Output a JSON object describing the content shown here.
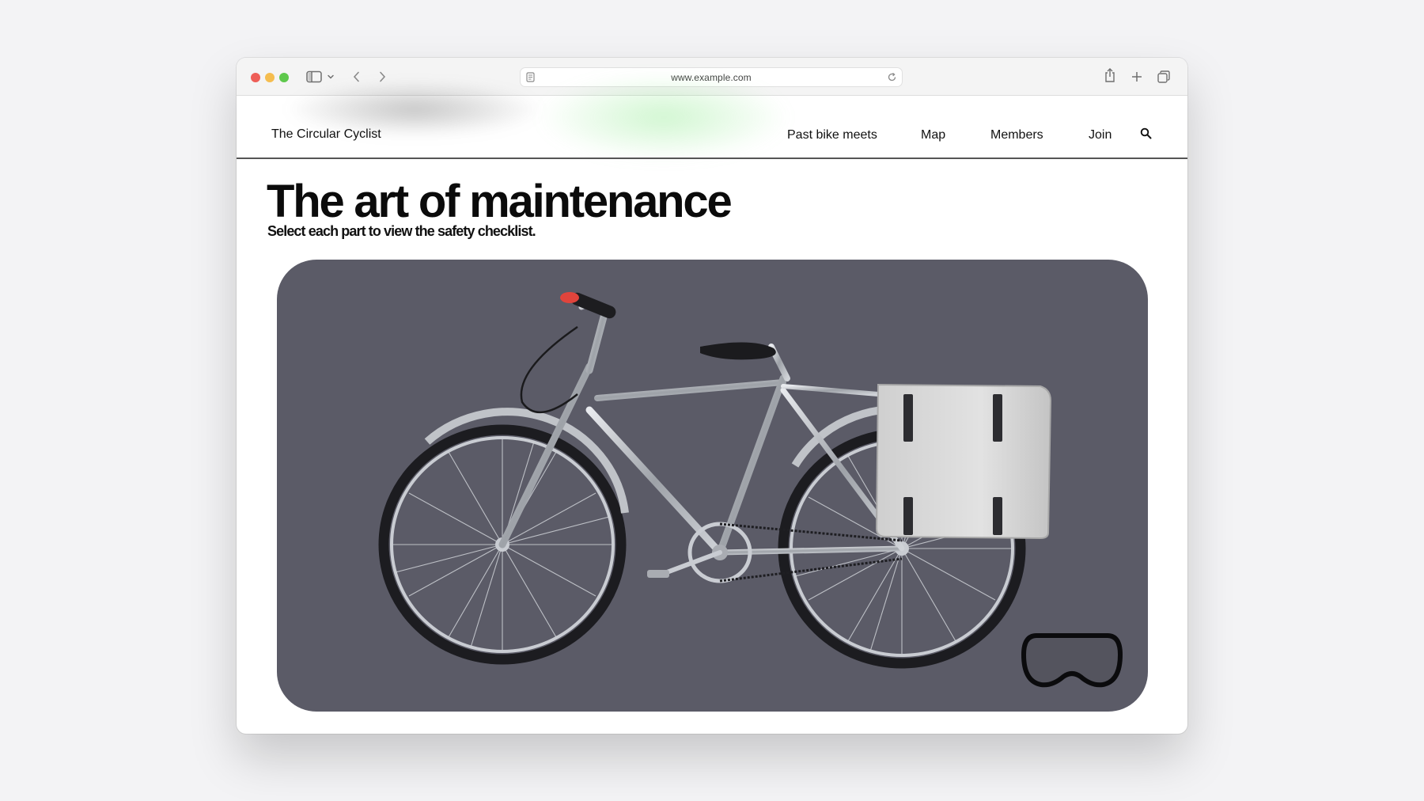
{
  "browser": {
    "url": "www.example.com",
    "icons": [
      "sidebar-icon",
      "chevron-down-icon",
      "back-icon",
      "forward-icon",
      "reader-icon",
      "reload-icon",
      "share-icon",
      "new-tab-icon",
      "tabs-overview-icon"
    ]
  },
  "site": {
    "title": "The Circular Cyclist",
    "nav": [
      {
        "label": "Past bike meets"
      },
      {
        "label": "Map"
      },
      {
        "label": "Members"
      },
      {
        "label": "Join"
      }
    ],
    "search_icon": "search-icon"
  },
  "page": {
    "headline": "The art of maintenance",
    "subhead": "Select each part to view the safety checklist."
  },
  "viewer": {
    "subject": "bicycle-3d-model",
    "badge_icon": "vision-pro-icon",
    "colors": {
      "stage": "#5b5b67",
      "bag": "#d9d9d9",
      "frame": "#b9bcc2",
      "light": "#e0443c"
    }
  }
}
